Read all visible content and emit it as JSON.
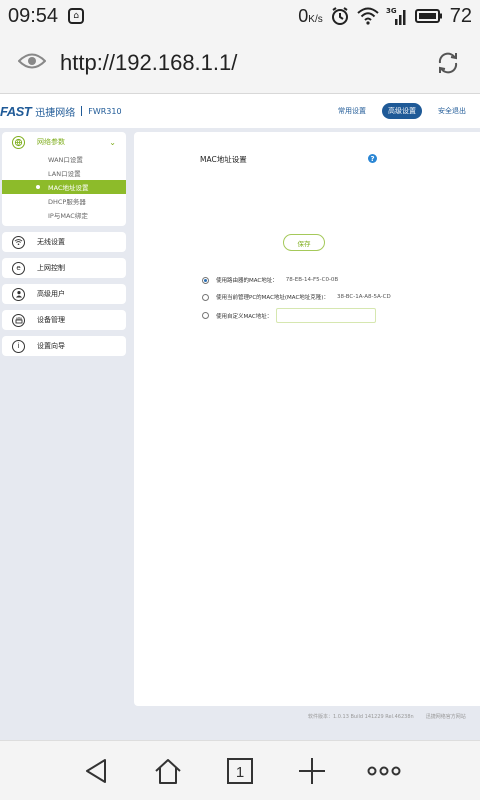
{
  "status": {
    "time": "09:54",
    "notification": "⌂",
    "speed": "0",
    "speed_unit": "K/s",
    "network": "3G",
    "battery": "72"
  },
  "browser": {
    "url": "http://192.168.1.1/",
    "tab_count": "1"
  },
  "router": {
    "brand": "FAST",
    "brand_cn": "迅捷网络",
    "model": "FWR310",
    "nav": [
      {
        "label": "常用设置",
        "active": false
      },
      {
        "label": "高级设置",
        "active": true
      },
      {
        "label": "安全退出",
        "active": false
      }
    ],
    "sidebar": {
      "network": {
        "label": "网络参数",
        "icon": "globe-icon",
        "items": [
          "WAN口设置",
          "LAN口设置",
          "MAC地址设置",
          "DHCP服务器",
          "IP与MAC绑定"
        ]
      },
      "sections": [
        {
          "label": "无线设置",
          "icon": "wifi-icon"
        },
        {
          "label": "上网控制",
          "icon": "e-icon"
        },
        {
          "label": "高级用户",
          "icon": "user-icon"
        },
        {
          "label": "设备管理",
          "icon": "device-icon"
        },
        {
          "label": "设置向导",
          "icon": "info-icon"
        }
      ]
    },
    "panel": {
      "title": "MAC地址设置",
      "options": [
        {
          "label": "使用路由器的MAC地址：",
          "value": "78-EB-14-F5-C0-0B",
          "checked": true
        },
        {
          "label": "使用当前管理PC的MAC地址(MAC地址克隆)：",
          "value": "38-BC-1A-A8-5A-CD",
          "checked": false
        },
        {
          "label": "使用自定义MAC地址：",
          "value": "",
          "checked": false
        }
      ],
      "save_label": "保存"
    },
    "footer": {
      "version": "软件版本：1.0.13 Build 141229 Rel.46238n",
      "site": "迅捷网络官方网站"
    }
  },
  "colors": {
    "brand_blue": "#1f5a97",
    "accent_green": "#8dbb2a",
    "help_blue": "#2a86d4"
  }
}
